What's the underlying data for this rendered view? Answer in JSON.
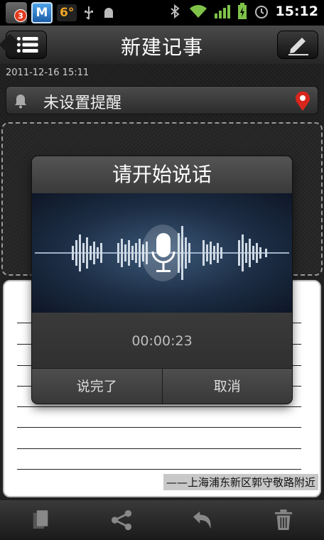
{
  "status_bar": {
    "notification_count": "3",
    "app_letter": "M",
    "temperature": "6°",
    "time": "15:12"
  },
  "header": {
    "title": "新建记事"
  },
  "note": {
    "datetime": "2011-12-16 15:11",
    "reminder_label": "未设置提醒",
    "location": "——上海浦东新区郭守敬路附近"
  },
  "voice_dialog": {
    "title": "请开始说话",
    "elapsed": "00:00:23",
    "done_label": "说完了",
    "cancel_label": "取消"
  },
  "colors": {
    "accent_red": "#e23a1e",
    "dialog_wave_bg": "#1c2d44"
  },
  "icons": [
    "list-icon",
    "edit-icon",
    "bell-icon",
    "location-pin-icon",
    "microphone-icon",
    "copy-icon",
    "share-icon",
    "undo-icon",
    "trash-icon"
  ]
}
